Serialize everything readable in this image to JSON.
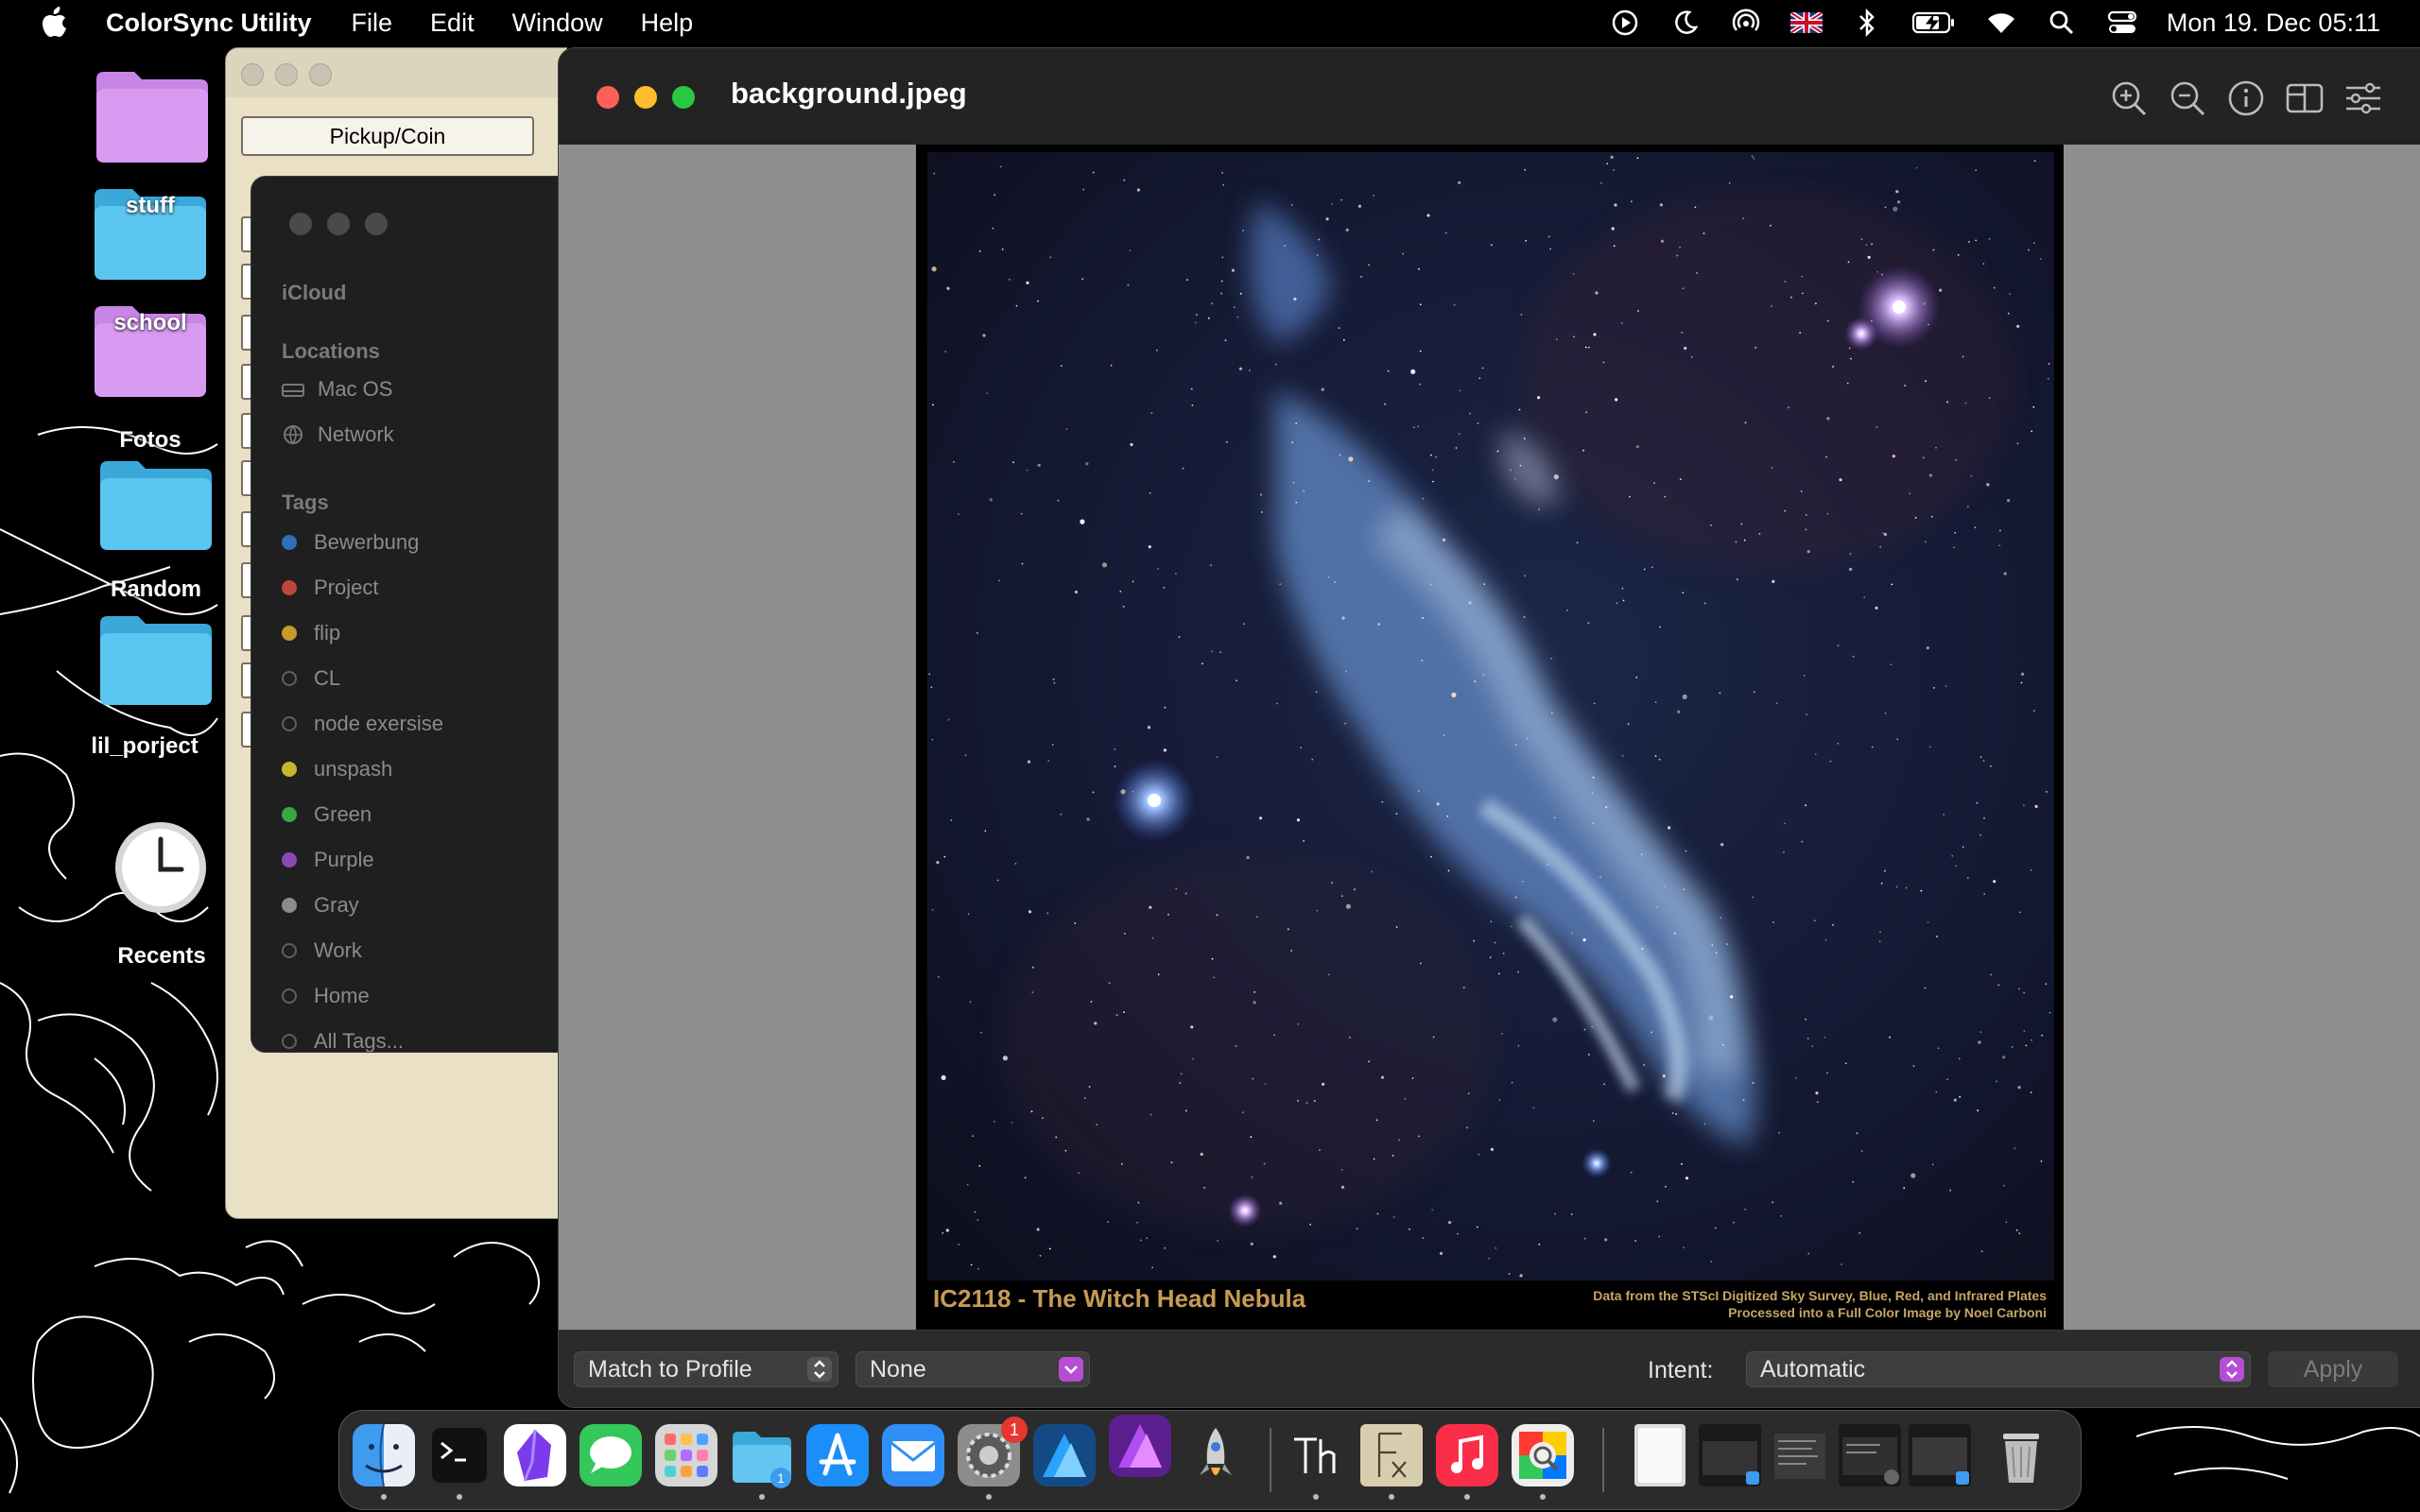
{
  "menubar": {
    "app_name": "ColorSync Utility",
    "menus": [
      "File",
      "Edit",
      "Window",
      "Help"
    ],
    "clock": "Mon 19. Dec  05:11",
    "status_icons": [
      "play-circle-icon",
      "moon-icon",
      "airdrop-icon",
      "uk-flag-icon",
      "bluetooth-icon",
      "battery-icon",
      "wifi-icon",
      "search-icon",
      "control-center-icon"
    ]
  },
  "desktop": {
    "icons": [
      "stuff",
      "school",
      "Fotos",
      "Random",
      "lil_porject",
      "Recents"
    ]
  },
  "back_window": {
    "button_label": "Pickup/Coin"
  },
  "finder_sidebar": {
    "icloud_label": "iCloud",
    "locations_label": "Locations",
    "locations": [
      "Mac OS",
      "Network"
    ],
    "tags_label": "Tags",
    "tags": [
      {
        "name": "Bewerbung",
        "color": "#2f6fb5"
      },
      {
        "name": "Project",
        "color": "#c0453a"
      },
      {
        "name": "flip",
        "color": "#c79a2a"
      },
      {
        "name": "CL",
        "color": ""
      },
      {
        "name": "node exersise",
        "color": ""
      },
      {
        "name": "unspash",
        "color": "#c9b52c"
      },
      {
        "name": "Green",
        "color": "#38a746"
      },
      {
        "name": "Purple",
        "color": "#8a4ab3"
      },
      {
        "name": "Gray",
        "color": "#8b8b8b"
      },
      {
        "name": "Work",
        "color": ""
      },
      {
        "name": "Home",
        "color": ""
      },
      {
        "name": "All Tags...",
        "color": ""
      }
    ]
  },
  "main_window": {
    "title": "background.jpeg",
    "toolbar_icons": [
      "zoom-in-icon",
      "zoom-out-icon",
      "info-icon",
      "sidebar-icon",
      "adjust-icon"
    ],
    "image": {
      "caption": "IC2118 - The Witch Head Nebula",
      "credit_line1": "Data from the STScI Digitized Sky Survey, Blue, Red, and Infrared Plates",
      "credit_line2": "Processed into a Full Color Image by Noel Carboni"
    },
    "bottom_bar": {
      "action_popup": "Match to Profile",
      "profile_popup": "None",
      "intent_label": "Intent:",
      "intent_popup": "Automatic",
      "apply_label": "Apply"
    }
  },
  "dock": {
    "apps": [
      "finder-icon",
      "terminal-icon",
      "obsidian-icon",
      "messages-icon",
      "launchpad-icon",
      "files-folder-icon",
      "app-store-icon",
      "mail-icon",
      "system-settings-icon",
      "affinity-designer-icon",
      "affinity-photo-icon",
      "rocket-icon",
      "th-app-icon",
      "font-app-icon",
      "music-icon",
      "colorsync-icon"
    ],
    "settings_badge": "1",
    "files_badge": "1"
  }
}
